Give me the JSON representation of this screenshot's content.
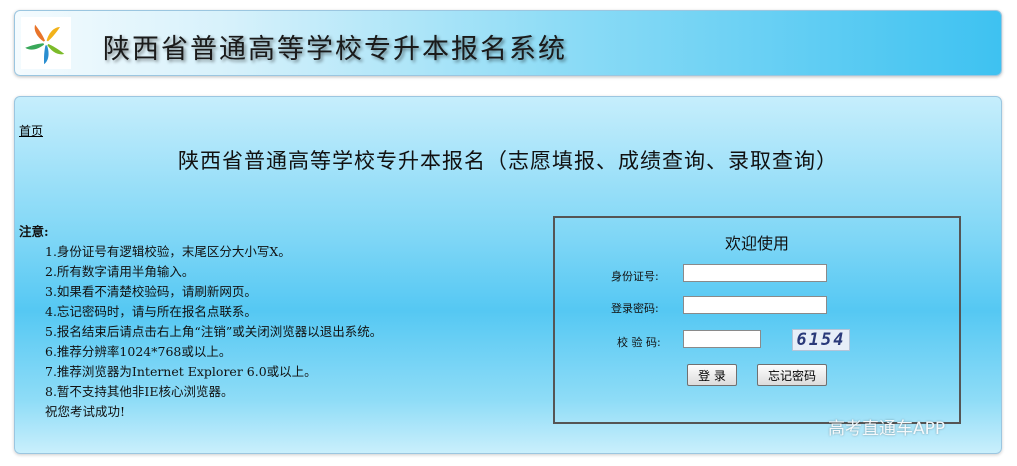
{
  "header": {
    "logo": "pinwheel-logo",
    "title": "陕西省普通高等学校专升本报名系统"
  },
  "main": {
    "home_link": "首页",
    "page_title": "陕西省普通高等学校专升本报名（志愿填报、成绩查询、录取查询）",
    "notice": {
      "heading": "注意:",
      "items": [
        "1.身份证号有逻辑校验，末尾区分大小写X。",
        "2.所有数字请用半角输入。",
        "3.如果看不清楚校验码，请刷新网页。",
        "4.忘记密码时，请与所在报名点联系。",
        "5.报名结束后请点击右上角“注销”或关闭浏览器以退出系统。",
        "6.推荐分辨率1024*768或以上。",
        "7.推荐浏览器为Internet Explorer 6.0或以上。",
        "8.暂不支持其他非IE核心浏览器。",
        "祝您考试成功!"
      ]
    }
  },
  "login": {
    "title": "欢迎使用",
    "id_label": "身份证号:",
    "id_value": "",
    "password_label": "登录密码:",
    "password_value": "",
    "captcha_label": "校 验 码:",
    "captcha_value": "",
    "captcha_text": "6154",
    "login_button": "登 录",
    "forgot_button": "忘记密码"
  },
  "watermark": "高考直通车APP"
}
